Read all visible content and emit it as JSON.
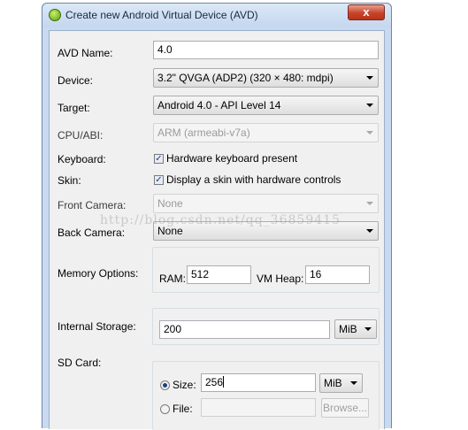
{
  "window": {
    "title": "Create new Android Virtual Device (AVD)",
    "close_label": "x"
  },
  "form": {
    "avd_name": {
      "label": "AVD Name:",
      "value": "4.0"
    },
    "device": {
      "label": "Device:",
      "value": "3.2\" QVGA (ADP2) (320 × 480: mdpi)"
    },
    "target": {
      "label": "Target:",
      "value": "Android 4.0 - API Level 14"
    },
    "cpu_abi": {
      "label": "CPU/ABI:",
      "value": "ARM (armeabi-v7a)"
    },
    "keyboard": {
      "label": "Keyboard:",
      "checkbox_label": "Hardware keyboard present",
      "checked": true
    },
    "skin": {
      "label": "Skin:",
      "checkbox_label": "Display a skin with hardware controls",
      "checked": true
    },
    "front_camera": {
      "label": "Front Camera:",
      "value": "None"
    },
    "back_camera": {
      "label": "Back Camera:",
      "value": "None"
    },
    "memory": {
      "label": "Memory Options:",
      "ram_label": "RAM:",
      "ram_value": "512",
      "vm_heap_label": "VM Heap:",
      "vm_heap_value": "16"
    },
    "internal_storage": {
      "label": "Internal Storage:",
      "value": "200",
      "unit": "MiB"
    },
    "sd_card": {
      "label": "SD Card:",
      "size_label": "Size:",
      "size_value": "256",
      "size_unit": "MiB",
      "file_label": "File:",
      "file_value": "",
      "browse_label": "Browse...",
      "selected": "size"
    }
  },
  "watermark": "http://blog.csdn.net/qq_36859415",
  "icons": {
    "app": "android-avd-icon",
    "check": "checkmark-icon",
    "dropdown": "chevron-down-icon"
  }
}
